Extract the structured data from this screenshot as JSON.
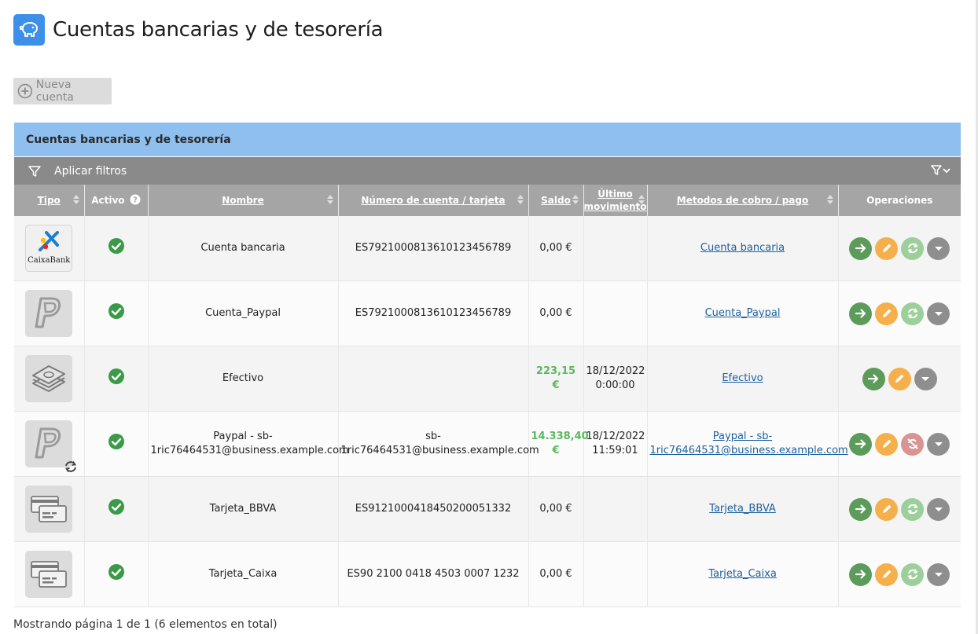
{
  "page": {
    "title": "Cuentas bancarias y de tesorería"
  },
  "toolbar": {
    "new_account_label": "Nueva cuenta"
  },
  "panel": {
    "title": "Cuentas bancarias y de tesorería",
    "filter_label": "Aplicar filtros"
  },
  "table": {
    "headers": {
      "tipo": "Tipo",
      "activo": "Activo",
      "nombre": "Nombre",
      "numero": "Número de cuenta / tarjeta",
      "saldo": "Saldo",
      "ultimo_line1": "Último",
      "ultimo_line2": "movimiento",
      "metodos": "Metodos de cobro / pago",
      "operaciones": "Operaciones"
    },
    "rows": [
      {
        "type_icon": "caixabank-logo",
        "logo_text": "CaixaBank",
        "active": true,
        "nombre": "Cuenta bancaria",
        "numero": "ES7921000813610123456789",
        "saldo": "0,00 €",
        "saldo_positive": false,
        "ultimo_fecha": "",
        "ultimo_hora": "",
        "metodo": "Cuenta bancaria",
        "sync_state": "enabled",
        "show_sync": true
      },
      {
        "type_icon": "paypal-icon",
        "active": true,
        "nombre": "Cuenta_Paypal",
        "numero": "ES7921000813610123456789",
        "saldo": "0,00 €",
        "saldo_positive": false,
        "ultimo_fecha": "",
        "ultimo_hora": "",
        "metodo": "Cuenta_Paypal",
        "sync_state": "enabled",
        "show_sync": true
      },
      {
        "type_icon": "cash-icon",
        "active": true,
        "nombre": "Efectivo",
        "numero": "",
        "saldo": "223,15 €",
        "saldo_positive": true,
        "ultimo_fecha": "18/12/2022",
        "ultimo_hora": "0:00:00",
        "metodo": "Efectivo",
        "sync_state": "none",
        "show_sync": false
      },
      {
        "type_icon": "paypal-icon",
        "synced": true,
        "active": true,
        "nombre": "Paypal - sb-1ric76464531@business.example.com",
        "numero": "sb-1ric76464531@business.example.com",
        "saldo": "14.338,40 €",
        "saldo_positive": true,
        "ultimo_fecha": "18/12/2022",
        "ultimo_hora": "11:59:01",
        "metodo": "Paypal - sb-1ric76464531@business.example.com",
        "sync_state": "disabled",
        "show_sync": true
      },
      {
        "type_icon": "credit-card-icon",
        "active": true,
        "nombre": "Tarjeta_BBVA",
        "numero": "ES9121000418450200051332",
        "saldo": "0,00 €",
        "saldo_positive": false,
        "ultimo_fecha": "",
        "ultimo_hora": "",
        "metodo": "Tarjeta_BBVA",
        "sync_state": "enabled",
        "show_sync": true
      },
      {
        "type_icon": "credit-card-icon",
        "active": true,
        "nombre": "Tarjeta_Caixa",
        "numero": "ES90 2100 0418 4503 0007 1232",
        "saldo": "0,00 €",
        "saldo_positive": false,
        "ultimo_fecha": "",
        "ultimo_hora": "",
        "metodo": "Tarjeta_Caixa",
        "sync_state": "enabled",
        "show_sync": true
      }
    ]
  },
  "footer": {
    "pagination_text": "Mostrando página 1 de 1 (6 elementos en total)"
  },
  "colors": {
    "header_icon": "#3d8fe8",
    "panel_title_bg": "#8fbfee",
    "filter_bar_bg": "#8a8a8a",
    "active_check": "#3a9a48",
    "op_go": "#5c9b5a",
    "op_edit": "#f5b04c",
    "op_sync": "#9ccf9a",
    "op_nosync": "#d99393",
    "op_more": "#8e8e8e",
    "positive_balance": "#5cb85c"
  }
}
